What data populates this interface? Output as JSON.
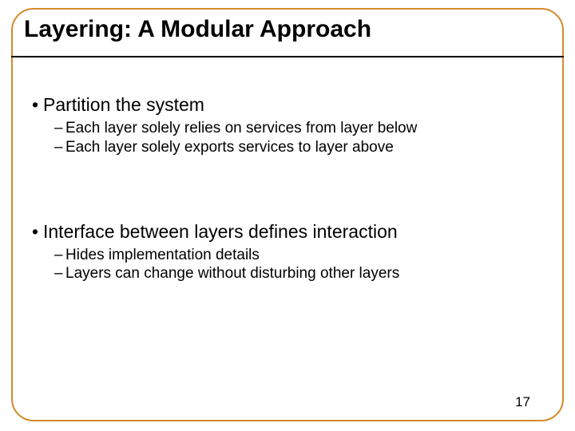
{
  "title": "Layering: A Modular Approach",
  "bullets": [
    {
      "main": "Partition the system",
      "subs": [
        "Each layer solely relies on services from layer below",
        "Each layer solely exports services to layer above"
      ]
    },
    {
      "main": "Interface between layers defines interaction",
      "subs": [
        "Hides implementation details",
        "Layers can change without disturbing other layers"
      ]
    }
  ],
  "pageNumber": "17"
}
